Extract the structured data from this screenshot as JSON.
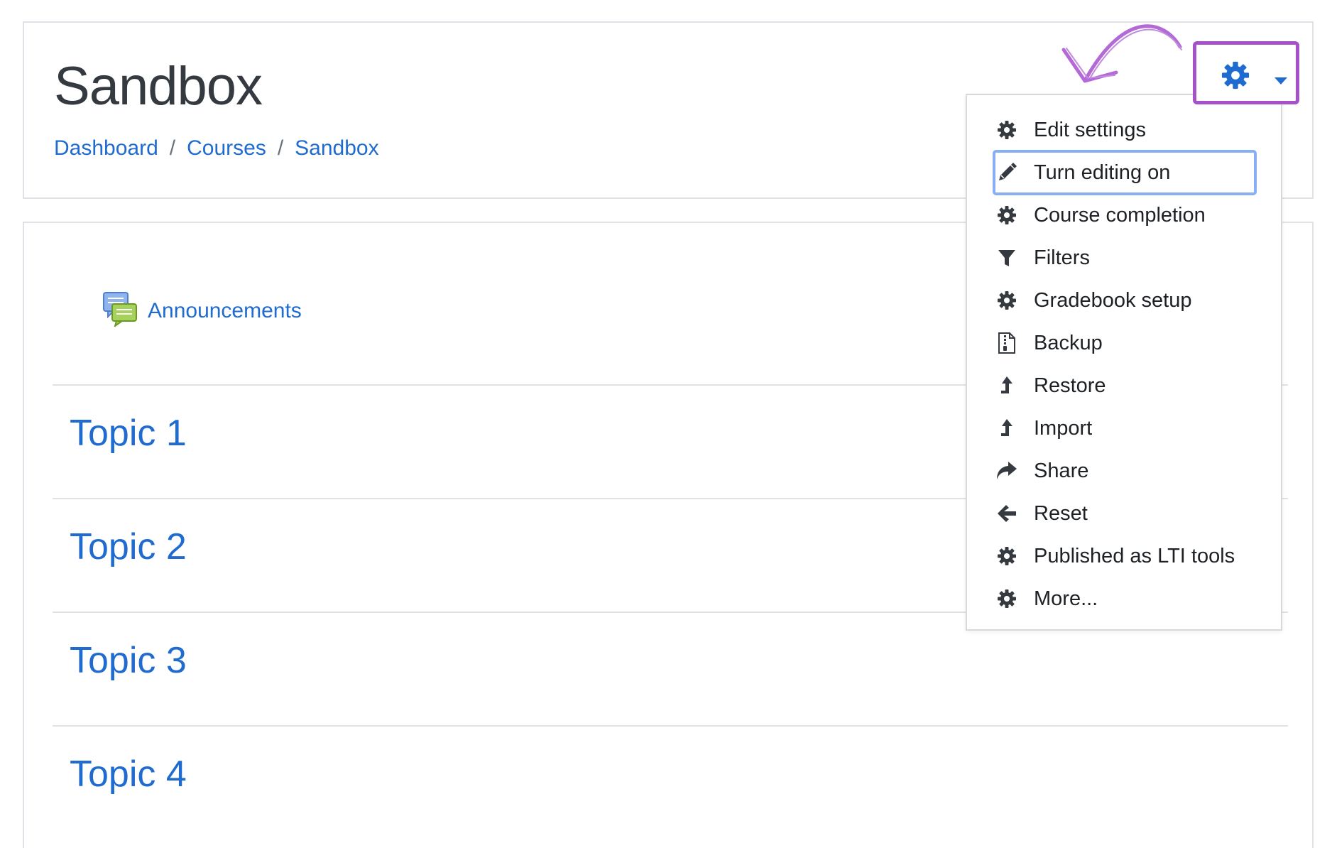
{
  "header": {
    "title": "Sandbox",
    "breadcrumb": [
      {
        "label": "Dashboard"
      },
      {
        "label": "Courses"
      },
      {
        "label": "Sandbox"
      }
    ],
    "separator": "/"
  },
  "settings_button": {
    "icon": "gear-icon",
    "caret_icon": "caret-down-icon",
    "accent": "#1f6bd0",
    "highlight_color": "#a551c7"
  },
  "content": {
    "announcement": {
      "label": "Announcements",
      "icon": "forum-icon"
    },
    "topics": [
      {
        "label": "Topic 1"
      },
      {
        "label": "Topic 2"
      },
      {
        "label": "Topic 3"
      },
      {
        "label": "Topic 4"
      }
    ]
  },
  "menu": {
    "items": [
      {
        "label": "Edit settings",
        "icon": "gear-icon"
      },
      {
        "label": "Turn editing on",
        "icon": "pencil-icon",
        "highlighted": true
      },
      {
        "label": "Course completion",
        "icon": "gear-icon"
      },
      {
        "label": "Filters",
        "icon": "filter-icon"
      },
      {
        "label": "Gradebook setup",
        "icon": "gear-icon"
      },
      {
        "label": "Backup",
        "icon": "file-archive-icon"
      },
      {
        "label": "Restore",
        "icon": "level-up-icon"
      },
      {
        "label": "Import",
        "icon": "level-up-icon"
      },
      {
        "label": "Share",
        "icon": "share-icon"
      },
      {
        "label": "Reset",
        "icon": "arrow-left-icon"
      },
      {
        "label": "Published as LTI tools",
        "icon": "gear-icon"
      },
      {
        "label": "More...",
        "icon": "gear-icon"
      }
    ]
  },
  "colors": {
    "link": "#1f6bd0",
    "border": "#dee2e6",
    "annotation": "#b36ad6"
  }
}
